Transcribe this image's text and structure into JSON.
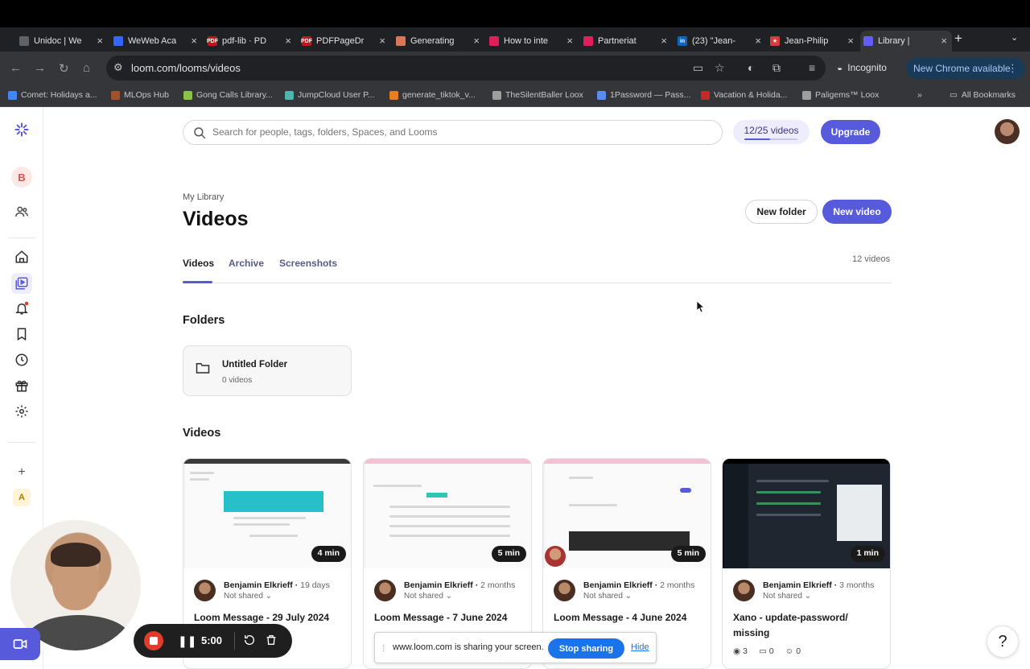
{
  "browser": {
    "tabs": [
      {
        "title": "Unidoc | We",
        "color": "#5f6368",
        "glyph": ""
      },
      {
        "title": "WeWeb Aca",
        "color": "#3366ff",
        "glyph": ""
      },
      {
        "title": "pdf-lib · PD",
        "color": "#c0161c",
        "glyph": "PDF"
      },
      {
        "title": "PDFPageDr",
        "color": "#c0161c",
        "glyph": "PDF"
      },
      {
        "title": "Generating",
        "color": "#d97757",
        "glyph": ""
      },
      {
        "title": "How to inte",
        "color": "#e01e5a",
        "glyph": ""
      },
      {
        "title": "Partneriat",
        "color": "#e01e5a",
        "glyph": ""
      },
      {
        "title": "(23) \"Jean-",
        "color": "#0a66c2",
        "glyph": "in"
      },
      {
        "title": "Jean-Philip",
        "color": "#d93a3a",
        "glyph": "★"
      },
      {
        "title": "Library |",
        "color": "#625df5",
        "glyph": ""
      }
    ],
    "url": "loom.com/looms/videos",
    "incognito_label": "Incognito",
    "update_label": "New Chrome available",
    "bookmarks": [
      {
        "label": "Comet: Holidays a...",
        "color": "#4285f4"
      },
      {
        "label": "MLOps Hub",
        "color": "#a0522d"
      },
      {
        "label": "Gong Calls Library...",
        "color": "#8bc34a"
      },
      {
        "label": "JumpCloud User P...",
        "color": "#4db6ac"
      },
      {
        "label": "generate_tiktok_v...",
        "color": "#e67e22"
      },
      {
        "label": "TheSilentBaller Loox",
        "color": "#9e9e9e"
      },
      {
        "label": "1Password — Pass...",
        "color": "#5a8dee"
      },
      {
        "label": "Vacation & Holida...",
        "color": "#c62828"
      },
      {
        "label": "Paligems™ Loox",
        "color": "#9e9e9e"
      }
    ],
    "all_bookmarks_label": "All Bookmarks"
  },
  "sidebar": {
    "workspace_initial": "B",
    "bottom_initial": "A",
    "notification_color": "#e23a2b"
  },
  "header": {
    "search_placeholder": "Search for people, tags, folders, Spaces, and Looms",
    "quota_label": "12/25 videos",
    "quota_fraction": 0.48,
    "upgrade_label": "Upgrade"
  },
  "library": {
    "breadcrumb": "My Library",
    "title": "Videos",
    "new_folder_label": "New folder",
    "new_video_label": "New video",
    "tabs": [
      "Videos",
      "Archive",
      "Screenshots"
    ],
    "video_count": "12 videos",
    "folders_heading": "Folders",
    "folder": {
      "name": "Untitled Folder",
      "count": "0 videos"
    },
    "videos_heading": "Videos",
    "videos": [
      {
        "duration": "4 min",
        "author": "Benjamin Elkrieff",
        "age": "19 days",
        "sharing": "Not shared",
        "title": "Loom Message - 29 July 2024"
      },
      {
        "duration": "5 min",
        "author": "Benjamin Elkrieff",
        "age": "2 months",
        "sharing": "Not shared",
        "title": "Loom Message - 7 June 2024"
      },
      {
        "duration": "5 min",
        "author": "Benjamin Elkrieff",
        "age": "2 months",
        "sharing": "Not shared",
        "title": "Loom Message - 4 June 2024"
      },
      {
        "duration": "1 min",
        "author": "Benjamin Elkrieff",
        "age": "3 months",
        "sharing": "Not shared",
        "title": "Xano - update-password/ missing",
        "views": "3",
        "comments": "0",
        "reactions": "0"
      }
    ]
  },
  "recorder": {
    "time": "5:00"
  },
  "share_bar": {
    "message": "www.loom.com is sharing your screen.",
    "stop_label": "Stop sharing",
    "hide_label": "Hide"
  },
  "help_label": "?",
  "colors": {
    "brand": "#565adb",
    "chrome_dark": "#35363a",
    "share_blue": "#1a73e8"
  }
}
